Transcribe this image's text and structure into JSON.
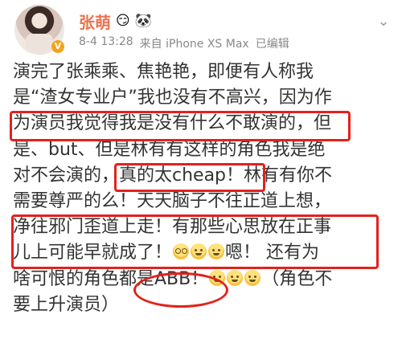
{
  "user": {
    "name": "张萌",
    "badge_icons": [
      "smirk-emoji-icon",
      "panda-emoji-icon"
    ],
    "badge_glyphs": [
      "😏",
      "🐼"
    ],
    "timestamp": "8-4 13:28",
    "source": "来自 iPhone XS Max",
    "edited": "已编辑",
    "verified_label": "V"
  },
  "post": {
    "lines": [
      "演完了张乘乘、焦艳艳，即便有人称我",
      "是“渣女专业户”我也没有不高兴，因为作",
      "为演员我觉得我是没有什么不敢演的，但",
      "是、but、但是林有有这样的角色我是绝",
      "对不会演的，真的太cheap！林有有你不",
      "需要尊严的么！天天脑子不往正道上想，",
      "净往邪门歪道上走！有那些心思放在正事",
      "儿上可能早就成了！",
      "啥可恨的角色都是ABB！"
    ],
    "line8_tail": "嗯！ 还有为",
    "line9_tail": "（角色不",
    "line10": "要上升演员）"
  },
  "annotation_color": "#e3211c"
}
